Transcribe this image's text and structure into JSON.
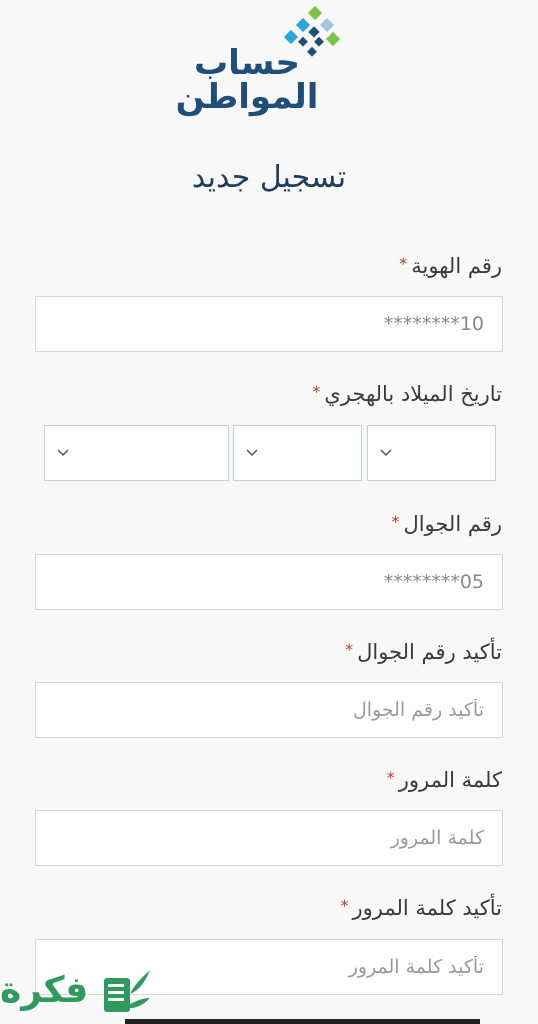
{
  "logo": {
    "line1": "حساب",
    "line2": "المواطن"
  },
  "page_title": "تسجيل جديد",
  "fields": {
    "id_number": {
      "label": "رقم الهوية",
      "value": "10********",
      "placeholder": ""
    },
    "birth_date": {
      "label": "تاريخ الميلاد بالهجري"
    },
    "mobile": {
      "label": "رقم الجوال",
      "value": "05********",
      "placeholder": ""
    },
    "mobile_confirm": {
      "label": "تأكيد رقم الجوال",
      "placeholder": "تأكيد رقم الجوال"
    },
    "password": {
      "label": "كلمة المرور",
      "placeholder": "كلمة المرور"
    },
    "password_confirm": {
      "label": "تأكيد كلمة المرور",
      "placeholder": "تأكيد كلمة المرور"
    }
  },
  "required_mark": "*",
  "watermark": {
    "text": "فكرة"
  },
  "colors": {
    "accent": "#1f4e79",
    "required": "#c0392b",
    "watermark": "#2e9a5e"
  },
  "icons": [
    "chevron-down-icon",
    "logo-dots-icon"
  ]
}
